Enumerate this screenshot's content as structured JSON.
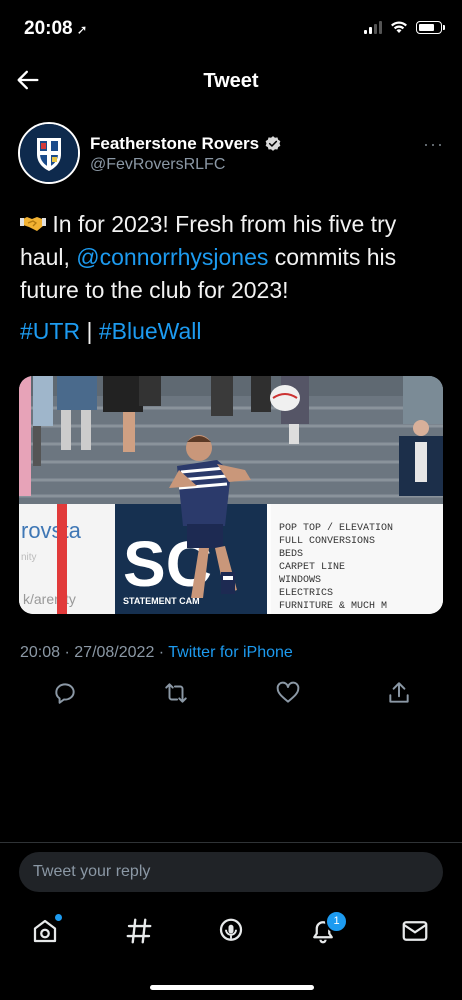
{
  "status_bar": {
    "time": "20:08"
  },
  "nav": {
    "title": "Tweet"
  },
  "author": {
    "name": "Featherstone Rovers",
    "handle": "@FevRoversRLFC"
  },
  "tweet": {
    "line1": " In for 2023! Fresh from his five try",
    "line2_pre": "haul, ",
    "mention": "@connorrhysjones",
    "line2_post": " commits his",
    "line3": "future to the club for 2023!",
    "hashtag1": "#UTR",
    "sep": " | ",
    "hashtag2": "#BlueWall"
  },
  "media": {
    "banner_left": "rovsta",
    "banner_left_sub": "nity",
    "banner_left_sub2": "k/arenity",
    "sponsor_logo": "SC",
    "sponsor_name": "STATEMENT CAM",
    "ad_lines": [
      "POP TOP / ELEVATION",
      "FULL CONVERSIONS",
      "BEDS",
      "CARPET LINE",
      "WINDOWS",
      "ELECTRICS",
      "FURNITURE & MUCH M"
    ]
  },
  "meta": {
    "time": "20:08",
    "date": "27/08/2022",
    "source": "Twitter for iPhone",
    "sep": " · "
  },
  "reply": {
    "placeholder": "Tweet your reply"
  },
  "tabs": {
    "notifications_badge": "1"
  },
  "colors": {
    "accent": "#1d9bf0",
    "background": "#000000",
    "muted": "#8b98a5"
  }
}
